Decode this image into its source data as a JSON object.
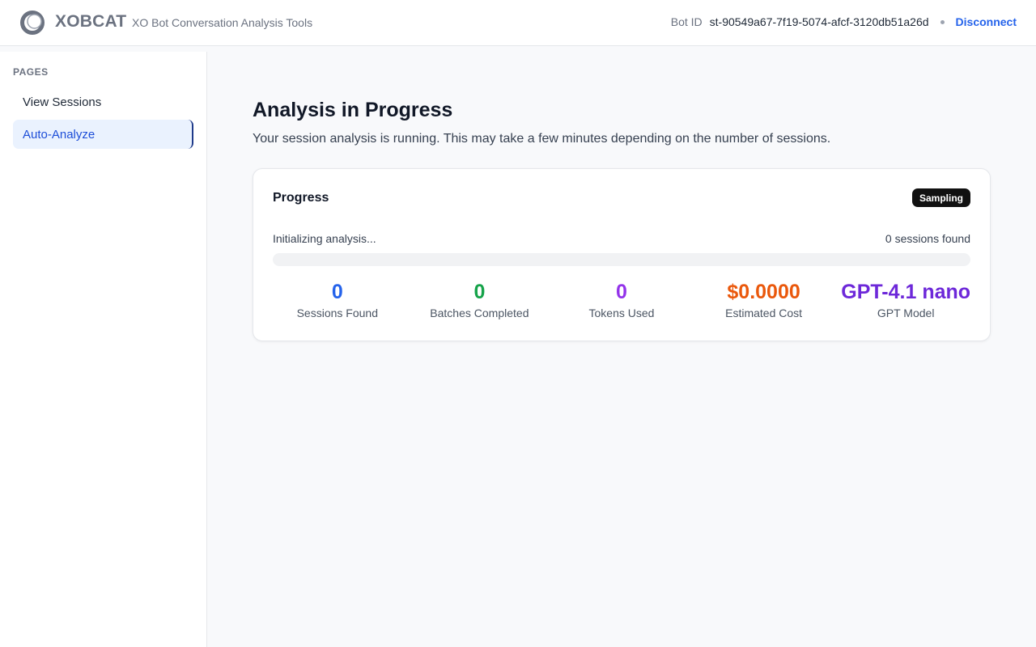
{
  "header": {
    "brand": "XOBCAT",
    "tagline": "XO Bot Conversation Analysis Tools",
    "bot_id_label": "Bot ID",
    "bot_id_value": "st-90549a67-7f19-5074-afcf-3120db51a26d",
    "disconnect_label": "Disconnect",
    "logo_icon": "ring-logo-icon"
  },
  "sidebar": {
    "section_label": "PAGES",
    "items": [
      {
        "label": "View Sessions",
        "active": false
      },
      {
        "label": "Auto-Analyze",
        "active": true
      }
    ]
  },
  "main": {
    "title": "Analysis in Progress",
    "subtitle": "Your session analysis is running. This may take a few minutes depending on the number of sessions."
  },
  "progress_card": {
    "title": "Progress",
    "badge": "Sampling",
    "status_text": "Initializing analysis...",
    "sessions_found_text": "0 sessions found",
    "progress_percent": 0,
    "stats": [
      {
        "value": "0",
        "label": "Sessions Found",
        "color": "#2563eb"
      },
      {
        "value": "0",
        "label": "Batches Completed",
        "color": "#16a34a"
      },
      {
        "value": "0",
        "label": "Tokens Used",
        "color": "#9333ea"
      },
      {
        "value": "$0.0000",
        "label": "Estimated Cost",
        "color": "#ea580c"
      },
      {
        "value": "GPT-4.1 nano",
        "label": "GPT Model",
        "color": "#6d28d9"
      }
    ]
  },
  "colors": {
    "accent": "#2563eb",
    "active_nav_bg": "#eaf2fe",
    "badge_bg": "#111111"
  }
}
